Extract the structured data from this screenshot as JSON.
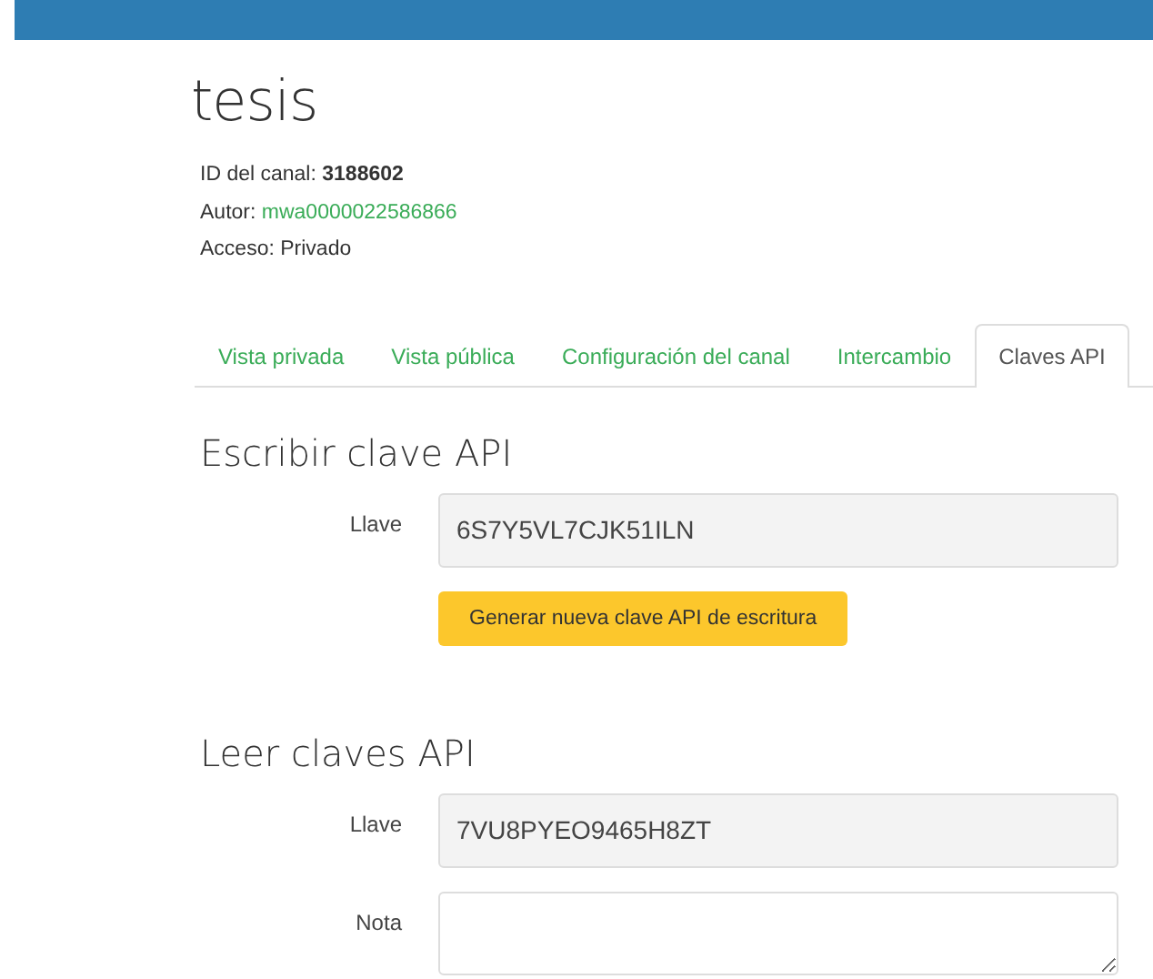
{
  "title": "tesis",
  "channel_info": [
    {
      "label": "ID del canal:",
      "value": "3188602",
      "kind": "bold"
    },
    {
      "label": "Autor:",
      "value": "mwa0000022586866",
      "kind": "link"
    },
    {
      "label": "Acceso:",
      "value": "Privado",
      "kind": "plain"
    }
  ],
  "tabs": [
    {
      "label": "Vista privada",
      "selected": false
    },
    {
      "label": "Vista pública",
      "selected": false
    },
    {
      "label": "Configuración del canal",
      "selected": false
    },
    {
      "label": "Intercambio",
      "selected": false
    },
    {
      "label": "Claves API",
      "selected": true
    }
  ],
  "sections": [
    {
      "heading": "Escribir clave API",
      "fields": [
        {
          "kind": "key",
          "label": "Llave",
          "value": "6S7Y5VL7CJK51ILN"
        }
      ],
      "button": "Generar nueva clave API de escritura"
    },
    {
      "heading": "Leer claves API",
      "fields": [
        {
          "kind": "key",
          "label": "Llave",
          "value": "7VU8PYEO9465H8ZT"
        },
        {
          "kind": "note",
          "label": "Nota"
        }
      ]
    }
  ]
}
